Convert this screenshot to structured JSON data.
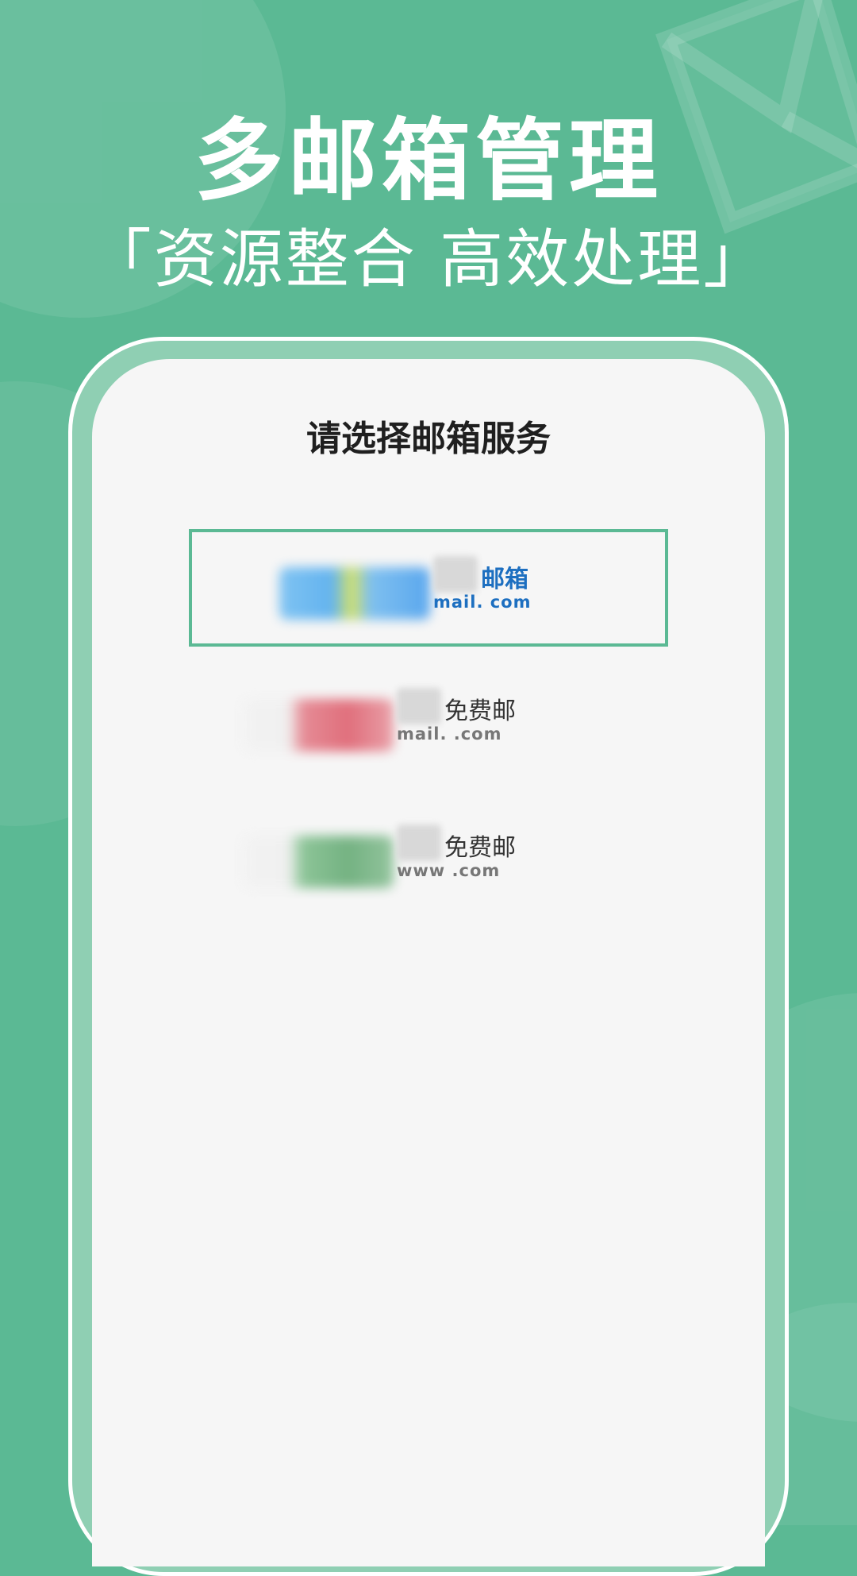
{
  "header": {
    "headline": "多邮箱管理",
    "subline": "「资源整合 高效处理」"
  },
  "screen": {
    "title": "请选择邮箱服务",
    "providers": [
      {
        "brand": "邮箱",
        "domain": "mail.  com",
        "selected": true
      },
      {
        "brand": "免费邮",
        "domain": "mail.    .com",
        "selected": false
      },
      {
        "brand": "免费邮",
        "domain": "www    .com",
        "selected": false
      }
    ]
  },
  "colors": {
    "background": "#5bb994",
    "selection_border": "#5bb994",
    "screen": "#f6f6f6"
  },
  "icons": [
    "envelope-icon"
  ]
}
